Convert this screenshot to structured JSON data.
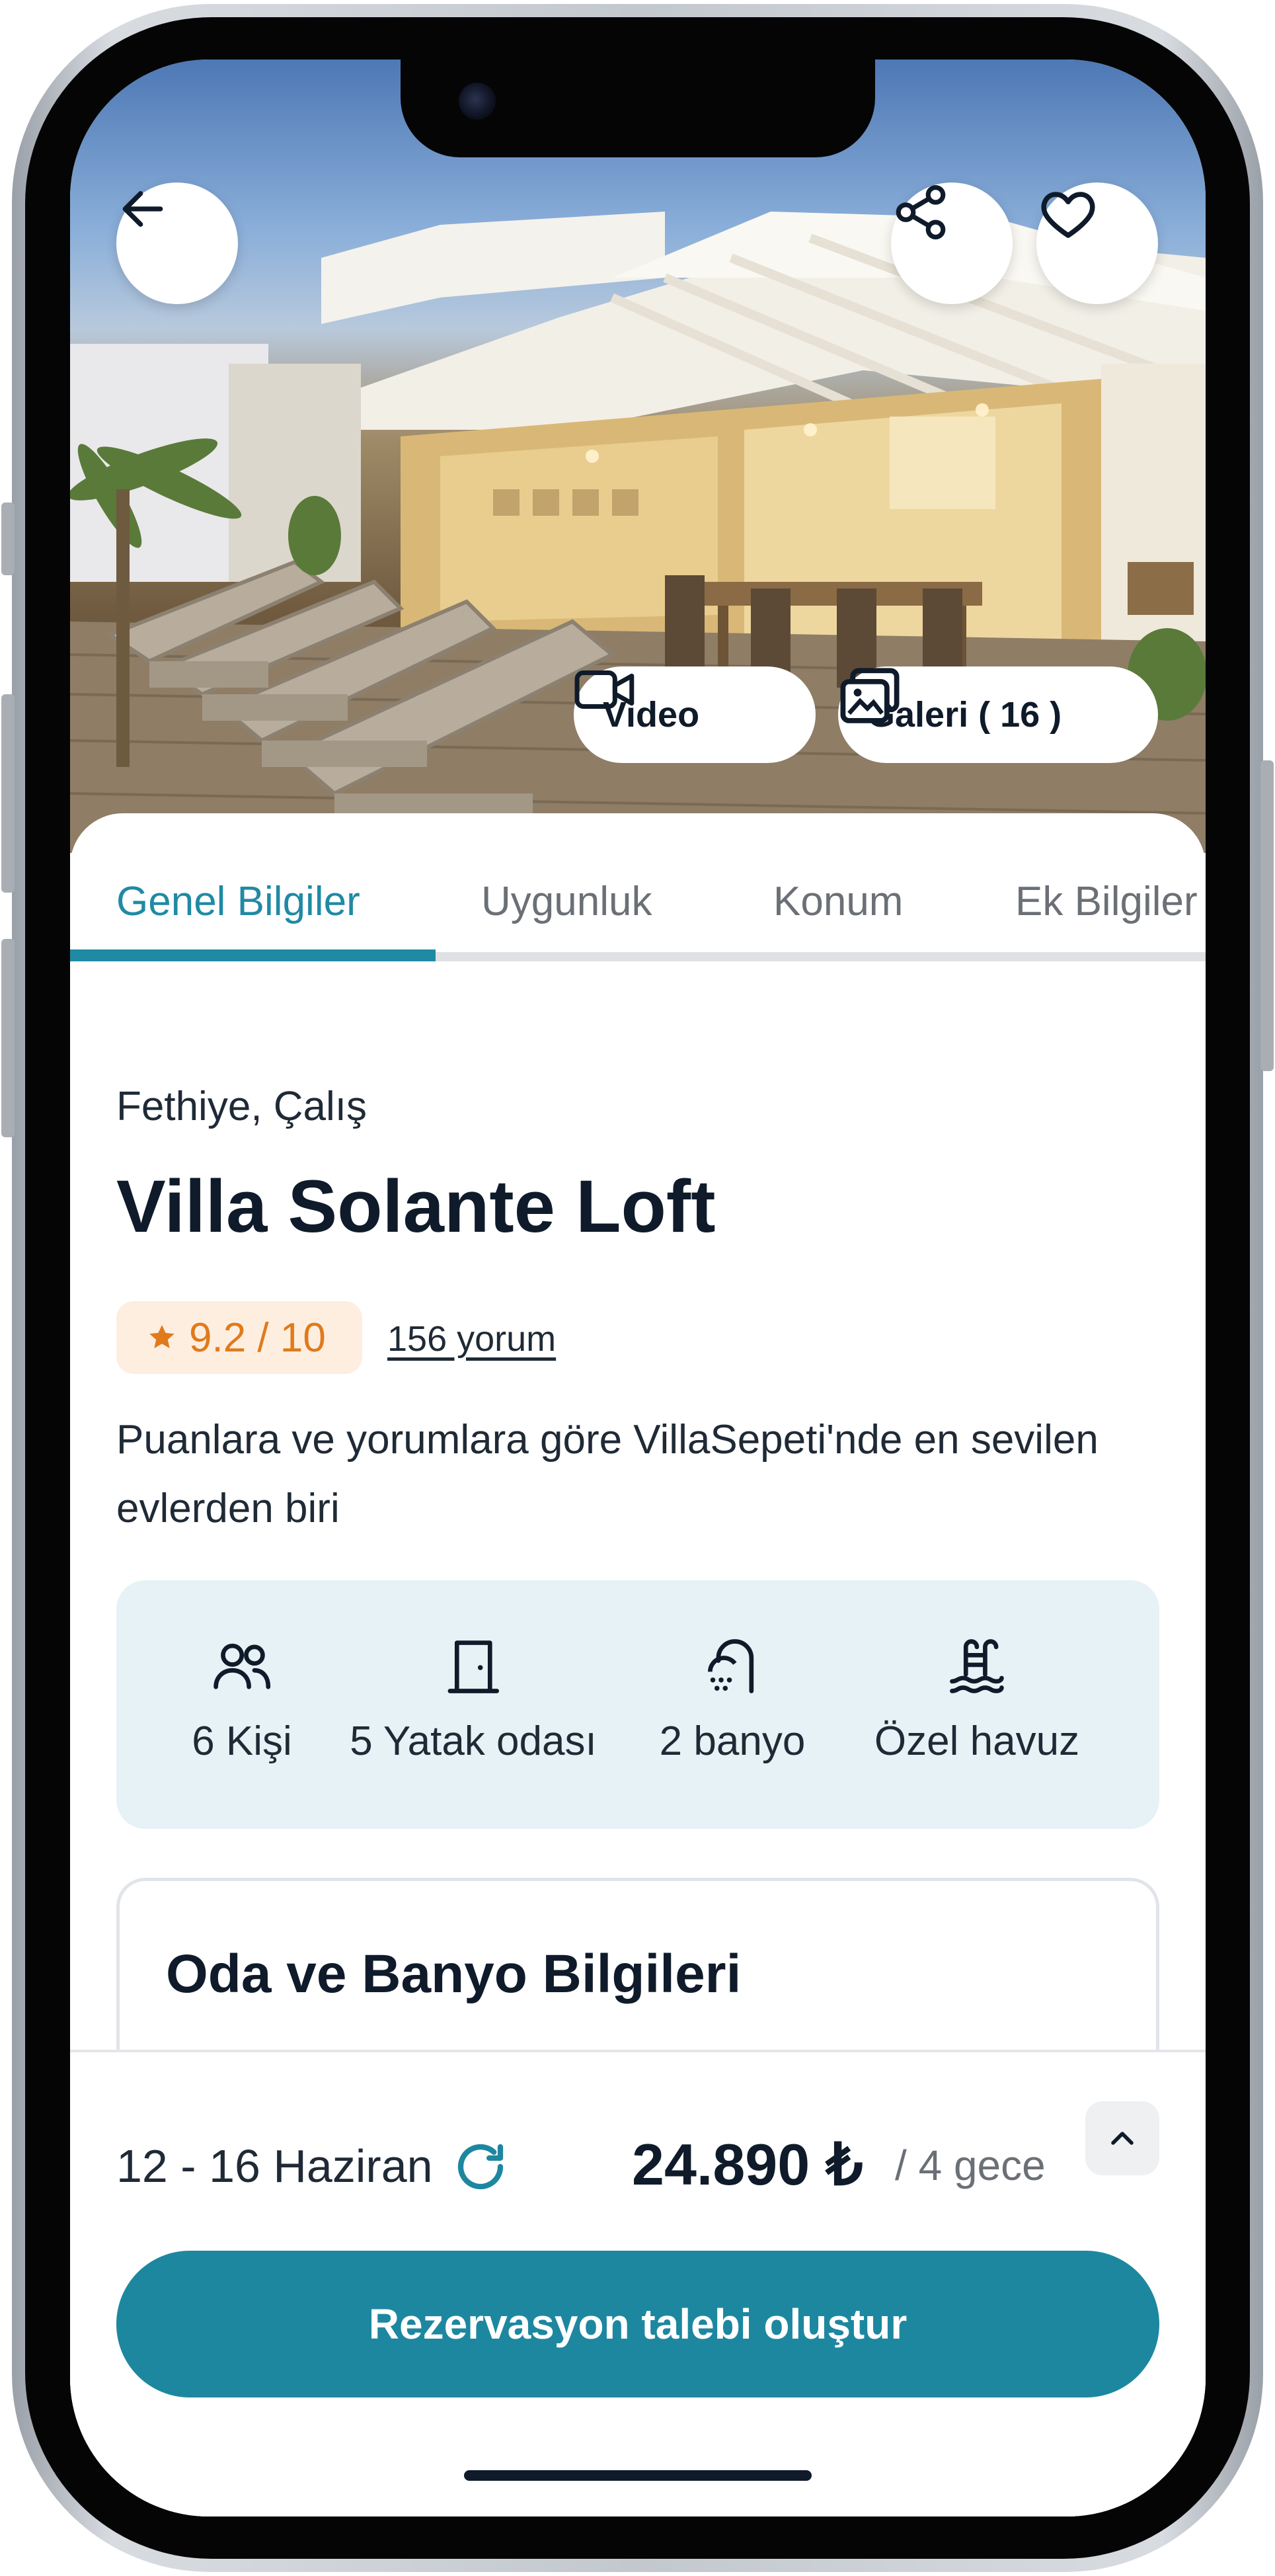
{
  "header": {
    "back_icon": "arrow-left-icon",
    "share_icon": "share-icon",
    "favorite_icon": "heart-icon",
    "video_label": "Video",
    "gallery_label": "Galeri ( 16 )"
  },
  "tabs": [
    {
      "label": "Genel Bilgiler",
      "active": true
    },
    {
      "label": "Uygunluk",
      "active": false
    },
    {
      "label": "Konum",
      "active": false
    },
    {
      "label": "Ek Bilgiler",
      "active": false
    }
  ],
  "listing": {
    "location": "Fethiye, Çalış",
    "title": "Villa Solante Loft",
    "rating": "9.2 / 10",
    "reviews": "156 yorum",
    "description": "Puanlara ve yorumlara göre VillaSepeti'nde en sevilen evlerden biri"
  },
  "features": [
    {
      "icon": "users-icon",
      "label": "6 Kişi"
    },
    {
      "icon": "door-icon",
      "label": "5 Yatak odası"
    },
    {
      "icon": "shower-icon",
      "label": "2 banyo"
    },
    {
      "icon": "pool-icon",
      "label": "Özel havuz"
    }
  ],
  "rooms_card": {
    "title": "Oda ve Banyo Bilgileri",
    "icon": "bed-icon"
  },
  "booking": {
    "dates": "12 - 16 Haziran",
    "price": "24.890 ₺",
    "per": "/ 4 gece",
    "cta": "Rezervasyon talebi oluştur"
  },
  "colors": {
    "accent": "#1d87a0",
    "rating_bg": "#fdeee0",
    "rating_text": "#e07a1c",
    "feature_bg": "#e6f2f5"
  }
}
